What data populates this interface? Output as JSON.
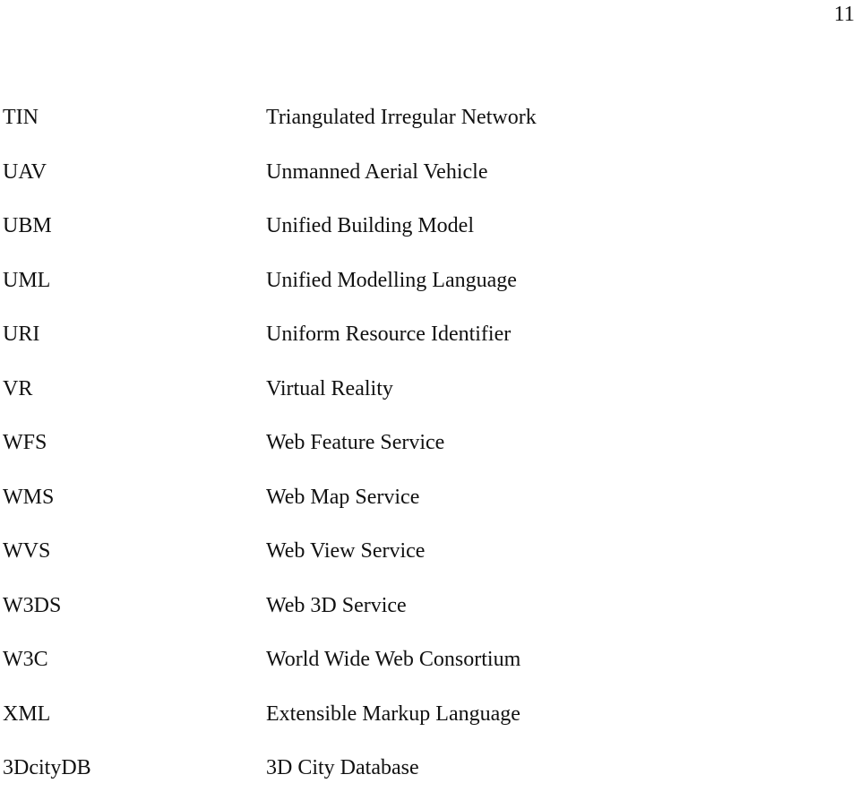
{
  "page": {
    "number": "11"
  },
  "abbreviations": [
    {
      "term": "TIN",
      "definition": "Triangulated Irregular Network"
    },
    {
      "term": "UAV",
      "definition": "Unmanned Aerial Vehicle"
    },
    {
      "term": "UBM",
      "definition": "Unified Building Model"
    },
    {
      "term": "UML",
      "definition": "Unified Modelling Language"
    },
    {
      "term": "URI",
      "definition": "Uniform Resource Identifier"
    },
    {
      "term": "VR",
      "definition": "Virtual Reality"
    },
    {
      "term": "WFS",
      "definition": "Web Feature Service"
    },
    {
      "term": "WMS",
      "definition": "Web Map Service"
    },
    {
      "term": "WVS",
      "definition": "Web View Service"
    },
    {
      "term": "W3DS",
      "definition": "Web 3D Service"
    },
    {
      "term": "W3C",
      "definition": "World Wide Web Consortium"
    },
    {
      "term": "XML",
      "definition": "Extensible Markup Language"
    },
    {
      "term": "3DcityDB",
      "definition": "3D City Database"
    }
  ]
}
